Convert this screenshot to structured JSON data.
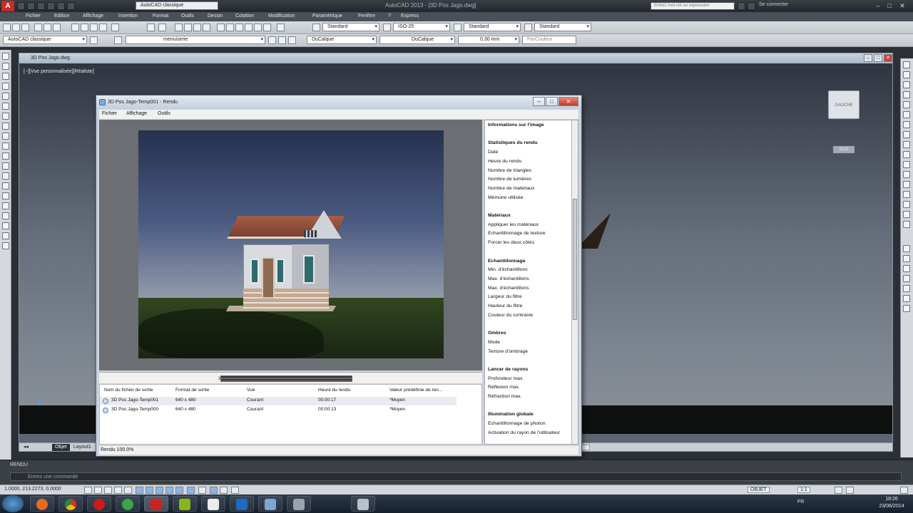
{
  "app": {
    "title": "AutoCAD 2013 - [3D Pos Jago.dwg]",
    "workspace": "AutoCAD classique",
    "search_placeholder": "Entrez mot-clé ou expression",
    "connect_label": "Se connecter",
    "logo_letter": "A"
  },
  "menu": [
    "Fichier",
    "Edition",
    "Affichage",
    "Insertion",
    "Format",
    "Outils",
    "Dessin",
    "Cotation",
    "Modification",
    "Paramétrique",
    "Fenêtre",
    "?",
    "Express"
  ],
  "toolbar2": {
    "text_style": "Standard",
    "dim_style": "ISO-25",
    "table_style": "Standard",
    "multileader_style": "Standard"
  },
  "toolbar3": {
    "workspace": "AutoCAD classique",
    "layer": "menuiserie",
    "color": "DuCalque",
    "linetype": "DuCalque",
    "lineweight": "0.30 mm",
    "plotstyle": "ParCouleur"
  },
  "drawing": {
    "title": "3D Pos Jago.dwg",
    "viewport_label": "[−][Vue personnalisée][Réaliste]",
    "viewcube_label": "GAUCHE",
    "wcs_label": "SCG",
    "tabs": [
      "Objet",
      "Layout1"
    ]
  },
  "render_window": {
    "title": "3D Pos Jago-Temp001 - Rendu",
    "menu": [
      "Fichier",
      "Affichage",
      "Outils"
    ],
    "progress_percent": 100,
    "status": "Rendu 100.0%",
    "history_columns": [
      "Nom du fichier de sortie",
      "Format de sortie",
      "Vue",
      "Heure du rendu",
      "Valeur prédéfinie de ren..."
    ],
    "history_rows": [
      {
        "file": "3D Pos Jago-Temp001",
        "format": "640 x 480",
        "view": "Courant",
        "time": "00:00:17",
        "preset": "*Moyen"
      },
      {
        "file": "3D Pos Jago-Temp000",
        "format": "640 x 480",
        "view": "Courant",
        "time": "00:00:13",
        "preset": "*Moyen"
      }
    ],
    "info_lines": [
      {
        "text": "Informations sur l'image",
        "h": true
      },
      {
        "text": "",
        "h": false
      },
      {
        "text": "Statistiques du rendu",
        "h": true
      },
      {
        "text": "Date",
        "h": false
      },
      {
        "text": "Heure du rendu",
        "h": false
      },
      {
        "text": "Nombre de triangles",
        "h": false
      },
      {
        "text": "Nombre de lumières",
        "h": false
      },
      {
        "text": "Nombre de matériaux",
        "h": false
      },
      {
        "text": "Mémoire utilisée",
        "h": false
      },
      {
        "text": "",
        "h": false
      },
      {
        "text": "Matériaux",
        "h": true
      },
      {
        "text": "Appliquer les matériaux",
        "h": false
      },
      {
        "text": "Echantillonnage de texture",
        "h": false
      },
      {
        "text": "Forcer les deux côtés",
        "h": false
      },
      {
        "text": "",
        "h": false
      },
      {
        "text": "Echantillonnage",
        "h": true
      },
      {
        "text": "Min. d'échantillons",
        "h": false
      },
      {
        "text": "Max. d'échantillons",
        "h": false
      },
      {
        "text": "Max. d'échantillons",
        "h": false
      },
      {
        "text": "Largeur du filtre",
        "h": false
      },
      {
        "text": "Hauteur du filtre",
        "h": false
      },
      {
        "text": "Couleur du contraste",
        "h": false
      },
      {
        "text": "",
        "h": false
      },
      {
        "text": "Ombres",
        "h": true
      },
      {
        "text": "Mode",
        "h": false
      },
      {
        "text": "Texture d'ombrage",
        "h": false
      },
      {
        "text": "",
        "h": false
      },
      {
        "text": "Lancer de rayons",
        "h": true
      },
      {
        "text": "Profondeur max.",
        "h": false
      },
      {
        "text": "Réflexion max.",
        "h": false
      },
      {
        "text": "Réfraction max.",
        "h": false
      },
      {
        "text": "",
        "h": false
      },
      {
        "text": "Illumination globale",
        "h": true
      },
      {
        "text": "Echantillonnage de photon",
        "h": false
      },
      {
        "text": "Activation du rayon de l'utilisateur",
        "h": false
      }
    ]
  },
  "command": {
    "label": "RENDU",
    "prompt": "Entrez une commande"
  },
  "status_bar": {
    "coords": "1.0000, 213.2273, 0.0000",
    "objet_label": "OBJET",
    "scale": "1:1"
  },
  "taskbar": {
    "tray_lang": "FR",
    "time": "18:26",
    "date": "23/06/2014"
  }
}
